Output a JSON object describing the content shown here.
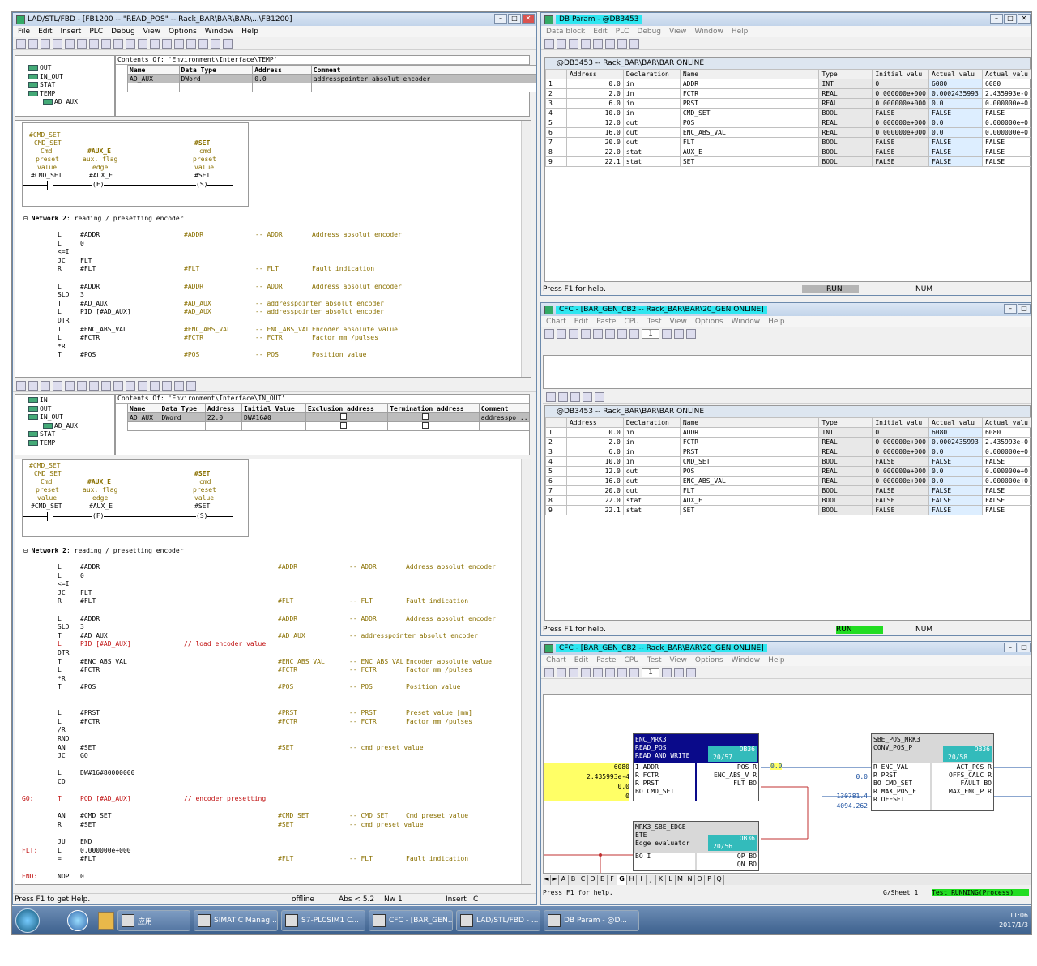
{
  "lad_window": {
    "title": "LAD/STL/FBD  - [FB1200 -- \"READ_POS\" -- Rack_BAR\\BAR\\BAR\\...\\FB1200]",
    "menu": [
      "File",
      "Edit",
      "Insert",
      "PLC",
      "Debug",
      "View",
      "Options",
      "Window",
      "Help"
    ],
    "contents_top": "Contents Of: 'Environment\\Interface\\TEMP'",
    "tree_top": [
      "OUT",
      "IN_OUT",
      "STAT",
      "TEMP",
      "AD_AUX"
    ],
    "decl_top_headers": [
      "Name",
      "Data Type",
      "Address",
      "Comment"
    ],
    "decl_top_row": [
      "AD_AUX",
      "DWord",
      "0.0",
      "addresspointer absolut encoder"
    ],
    "contents_bottom": "Contents Of: 'Environment\\Interface\\IN_OUT'",
    "tree_bottom": [
      "IN",
      "OUT",
      "IN_OUT",
      "AD_AUX",
      "STAT",
      "TEMP"
    ],
    "decl_bottom_headers": [
      "Name",
      "Data Type",
      "Address",
      "Initial Value",
      "Exclusion address",
      "Termination address",
      "Comment"
    ],
    "decl_bottom_row": [
      "AD_AUX",
      "DWord",
      "22.0",
      "DW#16#0",
      "",
      "",
      "addresspo..."
    ],
    "lad_labels": {
      "cmd_set_var": "#CMD_SET",
      "cmd_set": "CMD_SET",
      "c1": "Cmd",
      "c2": "preset",
      "c3": "value",
      "cmd_set_contact": "#CMD_SET",
      "aux_e": "#AUX_E",
      "aux1": "aux. flag",
      "aux2": "edge",
      "aux_e2": "#AUX_E",
      "f": "(F)",
      "set": "#SET",
      "s1": "cmd",
      "s2": "preset",
      "s3": "value",
      "set2": "#SET",
      "s": "(S)"
    },
    "network_title": "Network 2",
    "network_desc": ": reading / presetting encoder",
    "code_top": [
      [
        "L",
        "#ADDR",
        "#ADDR",
        "-- ADDR",
        "Address absolut encoder"
      ],
      [
        "L",
        "0",
        "",
        "",
        ""
      ],
      [
        "<=I",
        "",
        "",
        "",
        ""
      ],
      [
        "JC",
        "FLT",
        "",
        "",
        ""
      ],
      [
        "R",
        "#FLT",
        "#FLT",
        "-- FLT",
        "Fault indication"
      ],
      [
        "",
        "",
        "",
        "",
        ""
      ],
      [
        "L",
        "#ADDR",
        "#ADDR",
        "-- ADDR",
        "Address absolut encoder"
      ],
      [
        "SLD",
        "3",
        "",
        "",
        ""
      ],
      [
        "T",
        "#AD_AUX",
        "#AD_AUX",
        "-- addresspointer absolut encoder",
        ""
      ],
      [
        "L",
        "PID [#AD_AUX]",
        "#AD_AUX",
        "-- addresspointer absolut encoder",
        ""
      ],
      [
        "DTR",
        "",
        "",
        "",
        ""
      ],
      [
        "T",
        "#ENC_ABS_VAL",
        "#ENC_ABS_VAL",
        "-- ENC_ABS_VAL",
        "Encoder absolute value"
      ],
      [
        "L",
        "#FCTR",
        "#FCTR",
        "-- FCTR",
        "Factor mm /pulses"
      ],
      [
        "*R",
        "",
        "",
        "",
        ""
      ],
      [
        "T",
        "#POS",
        "#POS",
        "-- POS",
        "Position value"
      ]
    ],
    "code_bottom": [
      [
        "",
        "L",
        "#ADDR",
        "",
        "#ADDR",
        "-- ADDR",
        "Address absolut encoder"
      ],
      [
        "",
        "L",
        "0",
        "",
        "",
        "",
        ""
      ],
      [
        "",
        "<=I",
        "",
        "",
        "",
        "",
        ""
      ],
      [
        "",
        "JC",
        "FLT",
        "",
        "",
        "",
        ""
      ],
      [
        "",
        "R",
        "#FLT",
        "",
        "#FLT",
        "-- FLT",
        "Fault indication"
      ],
      [
        "",
        "",
        "",
        "",
        "",
        "",
        ""
      ],
      [
        "",
        "L",
        "#ADDR",
        "",
        "#ADDR",
        "-- ADDR",
        "Address absolut encoder"
      ],
      [
        "",
        "SLD",
        "3",
        "",
        "",
        "",
        ""
      ],
      [
        "",
        "T",
        "#AD_AUX",
        "",
        "#AD_AUX",
        "-- addresspointer absolut encoder",
        ""
      ],
      [
        "",
        "L",
        "PID [#AD_AUX]",
        "// load encoder value",
        "",
        "",
        ""
      ],
      [
        "",
        "DTR",
        "",
        "",
        "",
        "",
        ""
      ],
      [
        "",
        "T",
        "#ENC_ABS_VAL",
        "",
        "#ENC_ABS_VAL",
        "-- ENC_ABS_VAL",
        "Encoder absolute value"
      ],
      [
        "",
        "L",
        "#FCTR",
        "",
        "#FCTR",
        "-- FCTR",
        "Factor mm /pulses"
      ],
      [
        "",
        "*R",
        "",
        "",
        "",
        "",
        ""
      ],
      [
        "",
        "T",
        "#POS",
        "",
        "#POS",
        "-- POS",
        "Position value"
      ],
      [
        "",
        "",
        "",
        "",
        "",
        "",
        ""
      ],
      [
        "",
        "",
        "",
        "",
        "",
        "",
        ""
      ],
      [
        "",
        "L",
        "#PRST",
        "",
        "#PRST",
        "-- PRST",
        "Preset value [mm]"
      ],
      [
        "",
        "L",
        "#FCTR",
        "",
        "#FCTR",
        "-- FCTR",
        "Factor mm /pulses"
      ],
      [
        "",
        "/R",
        "",
        "",
        "",
        "",
        ""
      ],
      [
        "",
        "RND",
        "",
        "",
        "",
        "",
        ""
      ],
      [
        "",
        "AN",
        "#SET",
        "",
        "#SET",
        "-- cmd preset value",
        ""
      ],
      [
        "",
        "JC",
        "GO",
        "",
        "",
        "",
        ""
      ],
      [
        "",
        "",
        "",
        "",
        "",
        "",
        ""
      ],
      [
        "",
        "L",
        "DW#16#80000000",
        "",
        "",
        "",
        ""
      ],
      [
        "",
        "CD",
        "",
        "",
        "",
        "",
        ""
      ],
      [
        "",
        "",
        "",
        "",
        "",
        "",
        ""
      ],
      [
        "GO:",
        "T",
        "PQD [#AD_AUX]",
        "// encoder presetting",
        "",
        "",
        ""
      ],
      [
        "",
        "",
        "",
        "",
        "",
        "",
        ""
      ],
      [
        "",
        "AN",
        "#CMD_SET",
        "",
        "#CMD_SET",
        "-- CMD_SET",
        "Cmd preset value"
      ],
      [
        "",
        "R",
        "#SET",
        "",
        "#SET",
        "-- cmd preset value",
        ""
      ],
      [
        "",
        "",
        "",
        "",
        "",
        "",
        ""
      ],
      [
        "",
        "JU",
        "END",
        "",
        "",
        "",
        ""
      ],
      [
        "FLT:",
        "L",
        "0.000000e+000",
        "",
        "",
        "",
        ""
      ],
      [
        "",
        "=",
        "#FLT",
        "",
        "#FLT",
        "-- FLT",
        "Fault indication"
      ],
      [
        "",
        "",
        "",
        "",
        "",
        "",
        ""
      ],
      [
        "END:",
        "NOP",
        "0",
        "",
        "",
        "",
        ""
      ]
    ],
    "status_left": "Press F1 to get Help.",
    "status_offline": "offline",
    "status_abs": "Abs < 5.2",
    "status_nw": "Nw 1",
    "status_insert": "Insert",
    "status_c": "C"
  },
  "db_window": {
    "title": "DB Param - @DB3453",
    "menu": [
      "Data block",
      "Edit",
      "PLC",
      "Debug",
      "View",
      "Window",
      "Help"
    ],
    "subtitle": "@DB3453 -- Rack_BAR\\BAR\\BAR  ONLINE",
    "headers": [
      "",
      "Address",
      "Declaration",
      "Name",
      "Type",
      "Initial valu",
      "Actual valu",
      "Actual valu"
    ],
    "rows": [
      [
        "1",
        "0.0",
        "in",
        "ADDR",
        "INT",
        "0",
        "6080",
        "6080"
      ],
      [
        "2",
        "2.0",
        "in",
        "FCTR",
        "REAL",
        "0.000000e+000",
        "0.0002435993",
        "2.435993e-0"
      ],
      [
        "3",
        "6.0",
        "in",
        "PRST",
        "REAL",
        "0.000000e+000",
        "0.0",
        "0.000000e+0"
      ],
      [
        "4",
        "10.0",
        "in",
        "CMD_SET",
        "BOOL",
        "FALSE",
        "FALSE",
        "FALSE"
      ],
      [
        "5",
        "12.0",
        "out",
        "POS",
        "REAL",
        "0.000000e+000",
        "0.0",
        "0.000000e+0"
      ],
      [
        "6",
        "16.0",
        "out",
        "ENC_ABS_VAL",
        "REAL",
        "0.000000e+000",
        "0.0",
        "0.000000e+0"
      ],
      [
        "7",
        "20.0",
        "out",
        "FLT",
        "BOOL",
        "FALSE",
        "FALSE",
        "FALSE"
      ],
      [
        "8",
        "22.0",
        "stat",
        "AUX_E",
        "BOOL",
        "FALSE",
        "FALSE",
        "FALSE"
      ],
      [
        "9",
        "22.1",
        "stat",
        "SET",
        "BOOL",
        "FALSE",
        "FALSE",
        "FALSE"
      ]
    ],
    "status_help": "Press F1 for help.",
    "status_run": "RUN",
    "status_num": "NUM"
  },
  "cfc1_window": {
    "title": "CFC - [BAR_GEN_CB2 -- Rack_BAR\\BAR\\20_GEN  ONLINE]",
    "menu": [
      "Chart",
      "Edit",
      "Paste",
      "CPU",
      "Test",
      "View",
      "Options",
      "Window",
      "Help"
    ],
    "zoom": "1",
    "status_help": "Press F1 for help.",
    "status_run": "RUN",
    "status_num": "NUM"
  },
  "cfc2_window": {
    "title": "CFC - [BAR_GEN_CB2 -- Rack_BAR\\BAR\\20_GEN  ONLINE]",
    "menu": [
      "Chart",
      "Edit",
      "Paste",
      "CPU",
      "Test",
      "View",
      "Options",
      "Window",
      "Help"
    ],
    "zoom": "1",
    "block1": {
      "lines": [
        "ENC_MRK3",
        "READ_POS",
        "READ AND WRITE"
      ],
      "ob": "OB36",
      "seq": "20/57",
      "inputs": [
        "I  ADDR",
        "R  FCTR",
        "R  PRST",
        "BO CMD_SET"
      ],
      "outputs": [
        "POS  R",
        "ENC_ABS_V  R",
        "FLT  BO"
      ],
      "in_vals": [
        "6080",
        "2.435993e-4",
        "0.0",
        "0"
      ],
      "out_val": "0.0"
    },
    "block2": {
      "lines": [
        "SBE_POS_MRK3",
        "CONV_POS_P"
      ],
      "ob": "OB36",
      "seq": "20/58",
      "inputs": [
        "R  ENC_VAL",
        "R  PRST",
        "BO CMD_SET",
        "R  MAX_POS_F",
        "R  OFFSET"
      ],
      "outputs": [
        "ACT_POS  R",
        "OFFS_CALC  R",
        "FAULT  BO",
        "MAX_ENC_P  R"
      ],
      "in_vals": [
        "",
        "0.0",
        "",
        "130781.4",
        "4094.262"
      ]
    },
    "block3": {
      "lines": [
        "MRK3_SBE_EDGE",
        "ETE",
        "Edge evaluator"
      ],
      "ob": "OB36",
      "seq": "20/56",
      "inputs": [
        "BO I"
      ],
      "outputs": [
        "QP  BO",
        "QN  BO"
      ]
    },
    "sheet_tabs": [
      "A",
      "B",
      "C",
      "D",
      "E",
      "F",
      "G",
      "H",
      "I",
      "J",
      "K",
      "L",
      "M",
      "N",
      "O",
      "P",
      "Q"
    ],
    "status_help": "Press F1 for help.",
    "status_sheet": "G/Sheet 1",
    "status_test": "Test  RUNNING(Process)"
  },
  "taskbar": {
    "items": [
      "应用",
      "SIMATIC Manag...",
      "S7-PLCSIM1   C...",
      "CFC - [BAR_GEN...",
      "LAD/STL/FBD - ...",
      "DB Param - @D..."
    ],
    "time": "11:06",
    "date": "2017/1/3"
  },
  "colors": {
    "run": "#22dd22",
    "title_highlight": "#2ee6f0",
    "olive": "#8a7000",
    "red": "#c01010",
    "blue_block": "#0a0a8a"
  }
}
